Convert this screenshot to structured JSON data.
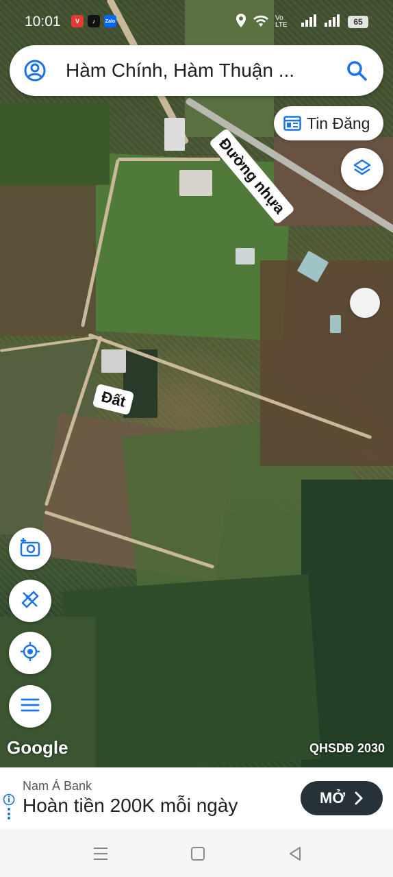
{
  "status": {
    "time": "10:01",
    "apps": [
      {
        "name": "V",
        "color": "#e53935"
      },
      {
        "name": "♪",
        "color": "#111111"
      },
      {
        "name": "Zalo",
        "color": "#0068ff"
      }
    ],
    "network_label": "Vo LTE",
    "battery": "65"
  },
  "search": {
    "text": "Hàm Chính, Hàm Thuận ..."
  },
  "chip": {
    "label": "Tin Đăng"
  },
  "map_labels": {
    "road": "Đường nhựa",
    "land": "Đất"
  },
  "attribution": {
    "logo": "Google",
    "layer_name": "QHSDĐ 2030"
  },
  "ad": {
    "brand": "Nam Á Bank",
    "title": "Hoàn tiền 200K mỗi ngày",
    "button": "MỞ"
  },
  "colors": {
    "accent": "#1a73e8",
    "ad_button": "#263238"
  }
}
